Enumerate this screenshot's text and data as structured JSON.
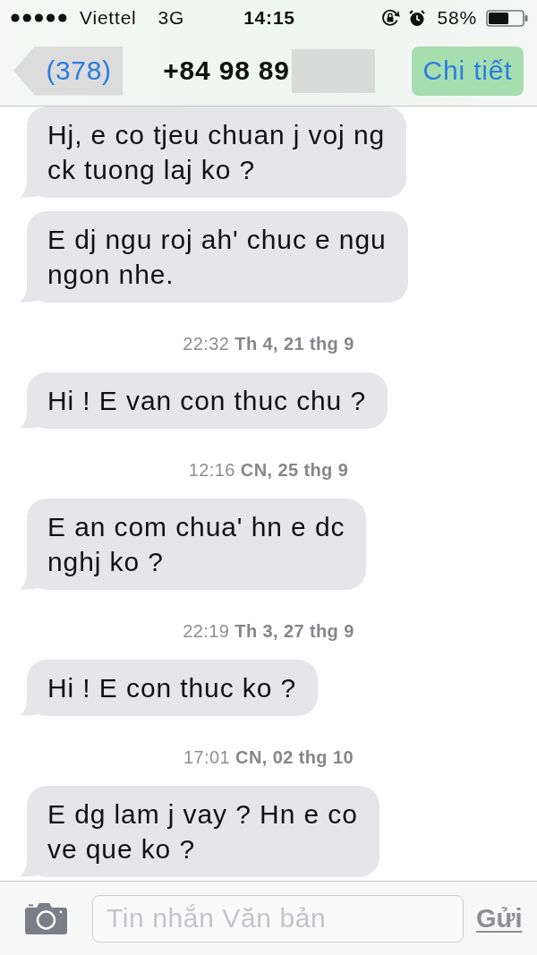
{
  "status_bar": {
    "carrier": "Viettel",
    "network": "3G",
    "time": "14:15",
    "battery": "58%"
  },
  "nav_bar": {
    "back": {
      "label": "(378)"
    },
    "title": "+84 98 89",
    "title_redacted": true,
    "details": {
      "label": "Chi tiết"
    }
  },
  "messages": [
    {
      "kind": "message",
      "lines": [
        "Hj, e co tjeu chuan j voj ng",
        "ck tuong laj ko ?"
      ]
    },
    {
      "kind": "message",
      "lines": [
        "E dj ngu roj ah' chuc e ngu",
        "ngon nhe."
      ]
    },
    {
      "kind": "timestamp",
      "text": "22:32 **Th 4, 21 thg 9**"
    },
    {
      "kind": "message",
      "lines": [
        "Hi ! E van con thuc chu ?"
      ]
    },
    {
      "kind": "timestamp",
      "text": "12:16 **CN, 25 thg 9**"
    },
    {
      "kind": "message",
      "lines": [
        "E an com chua' hn e dc",
        "nghj ko ?"
      ]
    },
    {
      "kind": "timestamp",
      "text": "22:19 **Th 3, 27 thg 9**"
    },
    {
      "kind": "message",
      "lines": [
        "Hi ! E con thuc ko ?"
      ]
    },
    {
      "kind": "timestamp",
      "text": "17:01 **CN, 02 thg 10**"
    },
    {
      "kind": "message",
      "lines": [
        "E dg lam j vay ? Hn e co",
        "ve que ko ?"
      ]
    }
  ],
  "composer": {
    "placeholder": "Tin nhắn Văn bản",
    "send": {
      "label": "Gửi",
      "disabled": true
    }
  }
}
